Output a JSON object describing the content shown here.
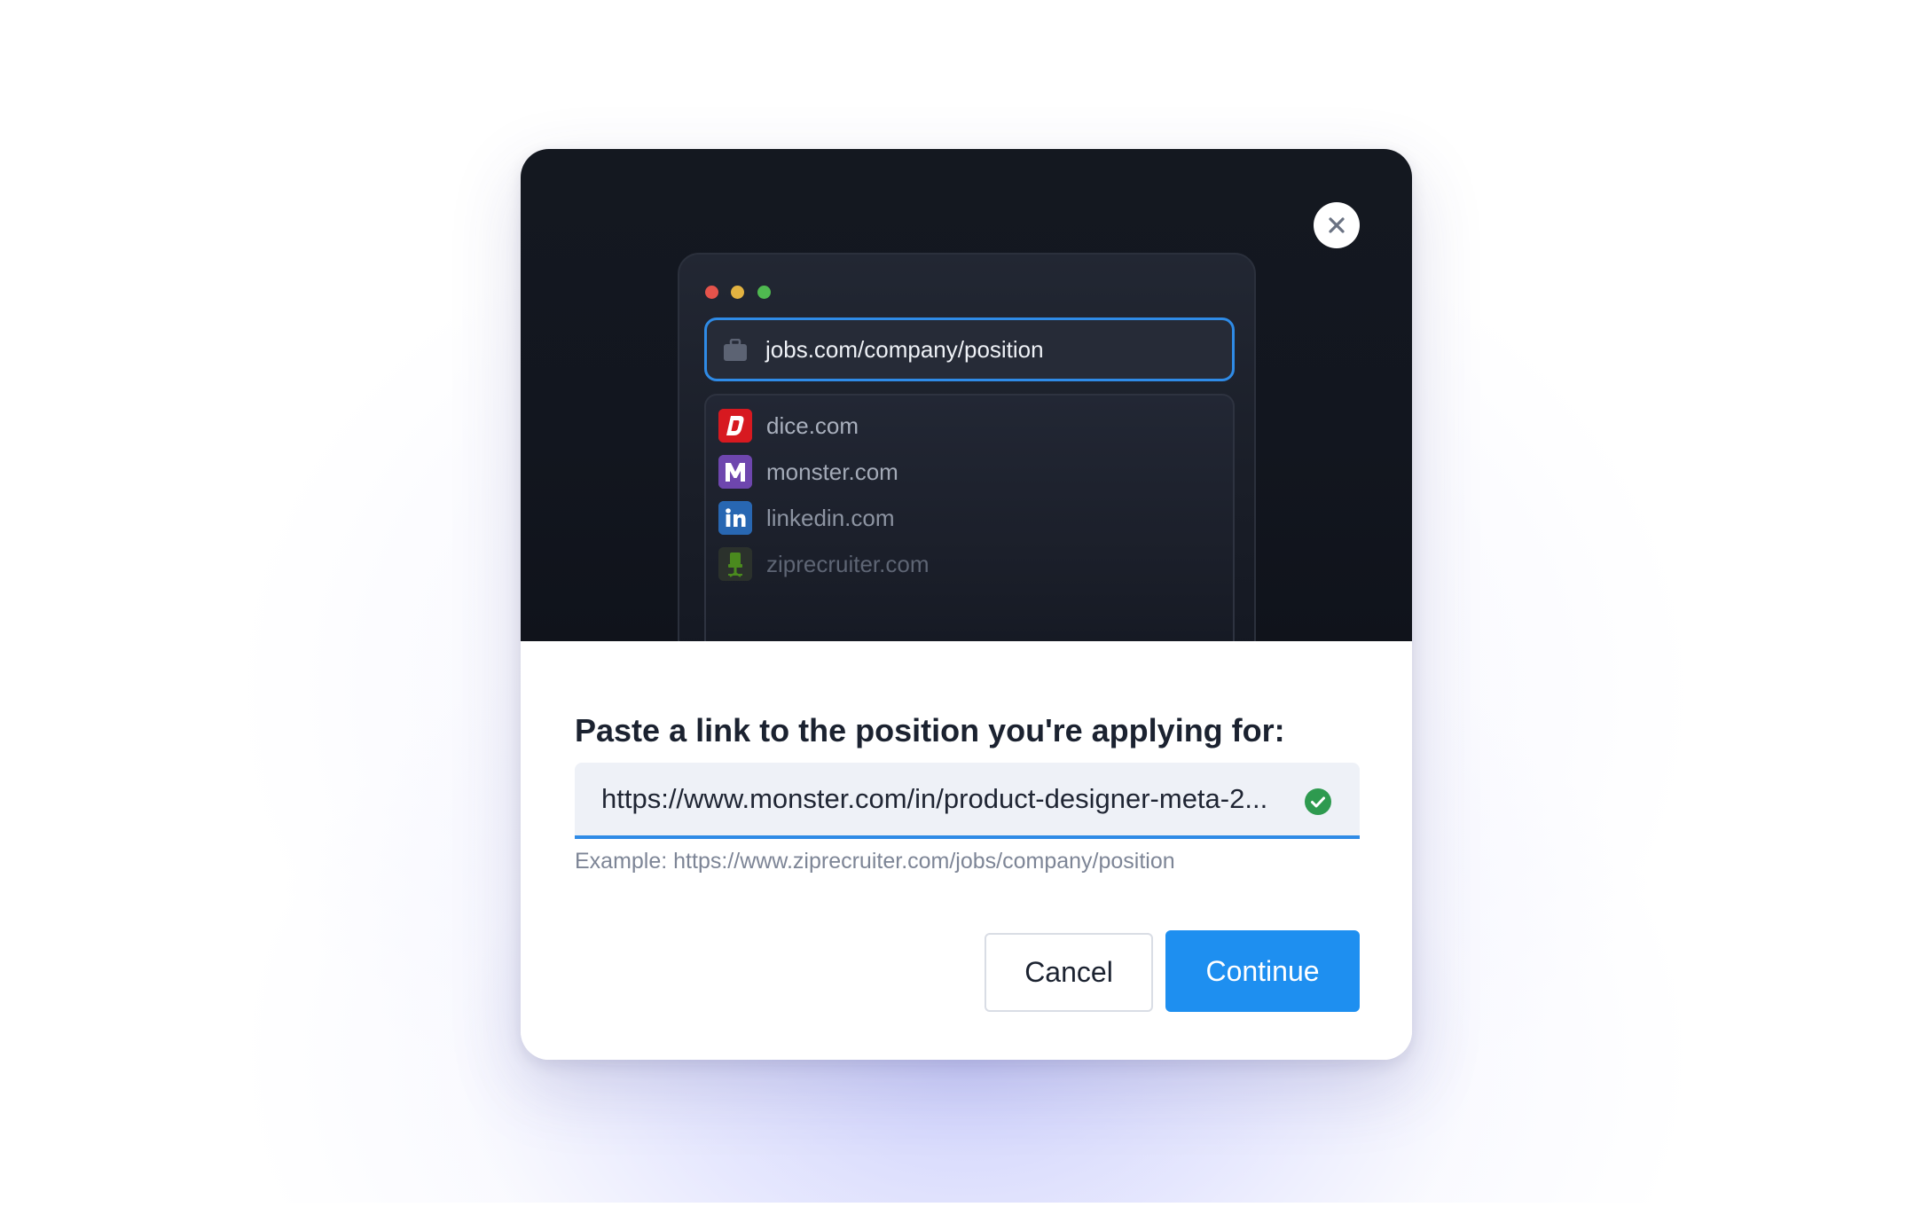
{
  "dialog": {
    "browser_mock": {
      "address": "jobs.com/company/position",
      "suggestions": [
        {
          "label": "dice.com",
          "icon": "dice-logo-icon",
          "color": "#d71920"
        },
        {
          "label": "monster.com",
          "icon": "monster-logo-icon",
          "color": "#6e46ae"
        },
        {
          "label": "linkedin.com",
          "icon": "linkedin-logo-icon",
          "color": "#2867b2"
        },
        {
          "label": "ziprecruiter.com",
          "icon": "ziprecruiter-logo-icon",
          "color": "#4a8a1e"
        }
      ]
    },
    "title": "Paste a link to the position you're applying for:",
    "url_input": {
      "value": "https://www.monster.com/in/product-designer-meta-2...",
      "valid": true
    },
    "hint": "Example: https://www.ziprecruiter.com/jobs/company/position",
    "buttons": {
      "cancel": "Cancel",
      "continue": "Continue"
    }
  },
  "colors": {
    "accent": "#1e8ff0",
    "valid": "#2e9a4f",
    "hero_bg": "#12161f"
  }
}
